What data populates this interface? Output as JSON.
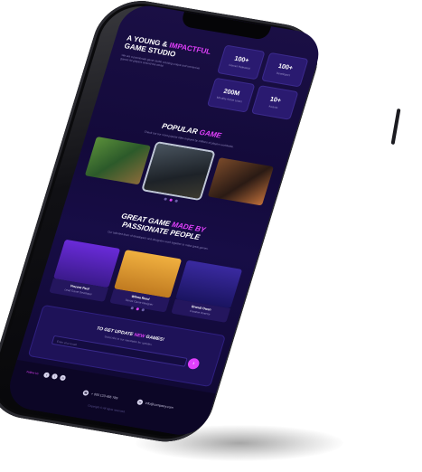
{
  "hero": {
    "title_line1": "A Young & ",
    "title_accent": "Impactful",
    "title_line2": "Game Studio",
    "description": "We are a passionate game studio creating unique and immersive games for players around the world.",
    "stats": [
      {
        "value": "100+",
        "label": "Games Released"
      },
      {
        "value": "100+",
        "label": "Developers"
      },
      {
        "value": "200M",
        "label": "Monthly Active Users"
      },
      {
        "value": "10+",
        "label": "Awards"
      }
    ]
  },
  "popular": {
    "title_plain": "Popular ",
    "title_accent": "Game",
    "description": "Check out our most popular titles enjoyed by millions of players worldwide.",
    "games": [
      "game-thumb-1",
      "game-thumb-2",
      "game-thumb-3"
    ]
  },
  "team": {
    "title_line1_plain": "Great Game ",
    "title_line1_accent": "Made By",
    "title_line2": "Passionate People",
    "description": "Our talented team of developers and designers work together to make great games.",
    "members": [
      {
        "name": "Vincent Paul",
        "role": "Lead Game Developer"
      },
      {
        "name": "Wilma Reed",
        "role": "Senior Game Designer"
      },
      {
        "name": "Brandi Owen",
        "role": "Creative Director"
      }
    ]
  },
  "subscribe": {
    "title_plain1": "To Get Update ",
    "title_accent": "New",
    "title_plain2": " Games!",
    "text": "Subscribe to our newsletter for updates.",
    "placeholder": "Enter your email",
    "button_icon": "arrow-right-icon"
  },
  "footer": {
    "social_label": "Follow Us",
    "social_icons": [
      "f",
      "t",
      "in"
    ],
    "phone": "+ 000 123 456 789",
    "email": "info@company.com",
    "copyright": "Copyright © All rights reserved."
  },
  "colors": {
    "accent": "#e040fb",
    "background": "#150b3f"
  }
}
